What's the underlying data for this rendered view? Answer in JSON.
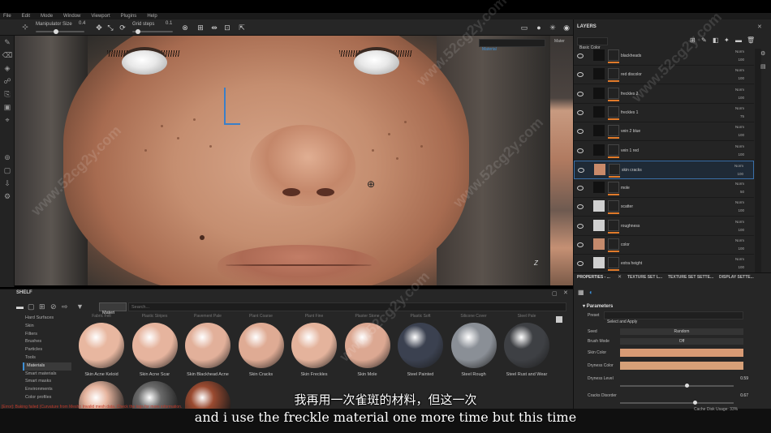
{
  "menu": [
    "File",
    "Edit",
    "Mode",
    "Window",
    "Viewport",
    "Plugins",
    "Help"
  ],
  "toolbar": {
    "manip_label": "Manipulator Size",
    "manip_value": "0.4",
    "grid_label": "Grid steps",
    "grid_value": "0.1"
  },
  "viewport": {
    "material_dropdown": "Material",
    "material_label": "Mater",
    "axis": "Z"
  },
  "left_tools": [
    "brush-icon",
    "eraser-icon",
    "projection-icon",
    "smudge-icon",
    "clone-icon",
    "fill-icon",
    "picker-icon",
    "camera-icon",
    "photoshop-icon",
    "export-icon",
    "settings-icon"
  ],
  "shelf": {
    "title": "SHELF",
    "filter_tag": "Materi",
    "search_placeholder": "Search...",
    "categories": [
      "Hard Surfaces",
      "Skin",
      "Filters",
      "Brushes",
      "Particles",
      "Tools",
      "Materials",
      "Smart materials",
      "Smart masks",
      "Environments",
      "Color profiles"
    ],
    "selected_category": "Materials",
    "top_row_labels": [
      "Fabric Felt",
      "Plastic Stripes",
      "Pavement Pale",
      "Plant Coarse",
      "Plant Fine",
      "Plaster Stone",
      "Plastic Soft",
      "Silicone Cover",
      "Steel Pale"
    ],
    "materials": [
      {
        "name": "Skin Acne Keloid",
        "color": "#e8b7a0"
      },
      {
        "name": "Skin Acne Scar",
        "color": "#e6b49e"
      },
      {
        "name": "Skin Blackhead Acne",
        "color": "#e2b09a"
      },
      {
        "name": "Skin Cracks",
        "color": "#dfab94"
      },
      {
        "name": "Skin Freckles",
        "color": "#e4b39c"
      },
      {
        "name": "Skin Mole",
        "color": "#dca892"
      },
      {
        "name": "Steel Painted",
        "color": "#3b4150"
      },
      {
        "name": "Steel Rough",
        "color": "#8a8f96"
      },
      {
        "name": "Steel Rust and Wear",
        "color": "#3e4044"
      }
    ]
  },
  "layers": {
    "title": "LAYERS",
    "channel": "Basic Color",
    "items": [
      {
        "name": "blackheads",
        "blend": "Norm",
        "opacity": "100",
        "thumb": "#111"
      },
      {
        "name": "red discolor",
        "blend": "Norm",
        "opacity": "100",
        "thumb": "#111"
      },
      {
        "name": "freckles 2",
        "blend": "Norm",
        "opacity": "100",
        "thumb": "#111"
      },
      {
        "name": "freckles 1",
        "blend": "Norm",
        "opacity": "75",
        "thumb": "#111"
      },
      {
        "name": "vein 2 blue",
        "blend": "Norm",
        "opacity": "100",
        "thumb": "#111"
      },
      {
        "name": "vein 1 red",
        "blend": "Norm",
        "opacity": "100",
        "thumb": "#111"
      },
      {
        "name": "skin cracks",
        "blend": "Norm",
        "opacity": "100",
        "thumb": "#c98a6a",
        "selected": true
      },
      {
        "name": "mole",
        "blend": "Norm",
        "opacity": "50",
        "thumb": "#111"
      },
      {
        "name": "scatter",
        "blend": "Norm",
        "opacity": "100",
        "thumb": "#d0d0d0"
      },
      {
        "name": "roughness",
        "blend": "Norm",
        "opacity": "100",
        "thumb": "#d0d0d0"
      },
      {
        "name": "color",
        "blend": "Norm",
        "opacity": "100",
        "thumb": "#c48a6c"
      },
      {
        "name": "extra height",
        "blend": "Norm",
        "opacity": "100",
        "thumb": "#d0d0d0"
      }
    ]
  },
  "properties": {
    "tabs": [
      "PROPERTIES - ...",
      "TEXTURE SET L...",
      "TEXTURE SET SETTE...",
      "DISPLAY SETTE..."
    ],
    "section": "Parameters",
    "preset_label": "Preset",
    "preset_value": "Select and Apply",
    "seed_label": "Seed",
    "seed_value": "Random",
    "brushmode_label": "Brush Mode",
    "brushmode_value": "Off",
    "skincolor_label": "Skin Color",
    "skincolor": "#d89b75",
    "dryness_label": "Dryness Color",
    "dryness": "#d6a078",
    "drylevel_label": "Dryness Level",
    "drylevel_value": "0.59",
    "drylevel": 0.59,
    "cracks_label": "Cracks Disorder",
    "cracks_value": "0.67",
    "cracks": 0.67
  },
  "status": {
    "message": "[Error]: Baking failed (Curvature from Mesh): Invalid mesh data. Check the logs for more information.",
    "cache": "Cache Disk Usage:    33%"
  },
  "subtitles": {
    "cn": "我再用一次雀斑的材料，但这一次",
    "en": "and i use the freckle material one more time but this time"
  },
  "watermark": "www.52cg2y.com"
}
